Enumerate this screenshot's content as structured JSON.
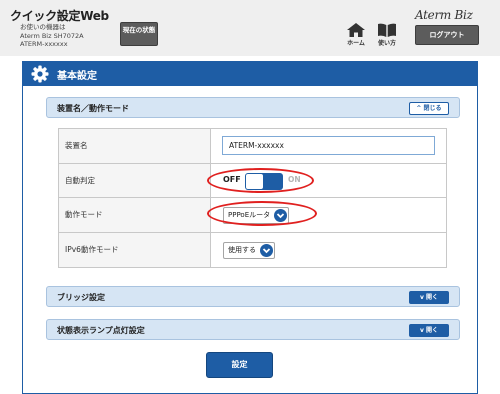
{
  "header": {
    "app_title": "クイック設定Web",
    "device_line1": "お使いの機器は",
    "device_line2": "Aterm Biz SH7072A",
    "device_line3": "ATERM-xxxxxx",
    "status_button": "現在の状態",
    "logo": "Aterm Biz",
    "home_label": "ホーム",
    "help_label": "使い方",
    "logout_label": "ログアウト"
  },
  "main": {
    "title": "基本設定"
  },
  "sections": {
    "device": {
      "title": "装置名／動作モード",
      "toggle": "閉じる",
      "toggle_icon": "chevron-up-icon"
    },
    "bridge": {
      "title": "ブリッジ設定",
      "toggle": "開く",
      "toggle_icon": "chevron-down-icon"
    },
    "lamp": {
      "title": "状態表示ランプ点灯設定",
      "toggle": "開く",
      "toggle_icon": "chevron-down-icon"
    }
  },
  "fields": {
    "device_name": {
      "label": "装置名",
      "value": "ATERM-xxxxxx"
    },
    "auto_detect": {
      "label": "自動判定",
      "off_label": "OFF",
      "on_label": "ON",
      "state": "OFF"
    },
    "operation_mode": {
      "label": "動作モード",
      "selected": "PPPoEルータ"
    },
    "ipv6_mode": {
      "label": "IPv6動作モード",
      "selected": "使用する"
    }
  },
  "submit_label": "設定",
  "colors": {
    "accent": "#1e5da5",
    "highlight": "#e0201f",
    "section_bg": "#d6e5f4"
  }
}
